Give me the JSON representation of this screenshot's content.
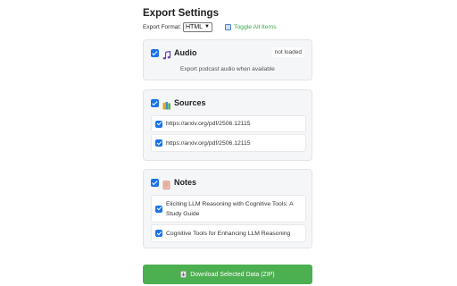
{
  "header": {
    "title": "Export Settings",
    "format_label": "Export Format:",
    "format_value": "HTML",
    "toggle_label": "Toggle All Items"
  },
  "audio": {
    "label": "Audio",
    "checked": true,
    "status": "not loaded",
    "description": "Export podcast audio when available"
  },
  "sources": {
    "label": "Sources",
    "checked": true,
    "items": [
      {
        "text": "https://arxiv.org/pdf/2506.12115",
        "checked": true
      },
      {
        "text": "https://arxiv.org/pdf/2506.12115",
        "checked": true
      }
    ]
  },
  "notes": {
    "label": "Notes",
    "checked": true,
    "items": [
      {
        "text": "Eliciting LLM Reasoning with Cognitive Tools: A Study Guide",
        "checked": true
      },
      {
        "text": "Cognitive Tools for Enhancing LLM Reasoning",
        "checked": true
      }
    ]
  },
  "download": {
    "label": "Download Selected Data (ZIP)"
  },
  "colors": {
    "accent_blue": "#1a73e8",
    "toggle_green": "#3aa84a",
    "button_green": "#4caf50"
  },
  "icons": {
    "audio": "music-note-icon",
    "sources": "books-icon",
    "notes": "memo-icon",
    "toggle": "toggle-icon",
    "download": "download-icon"
  }
}
